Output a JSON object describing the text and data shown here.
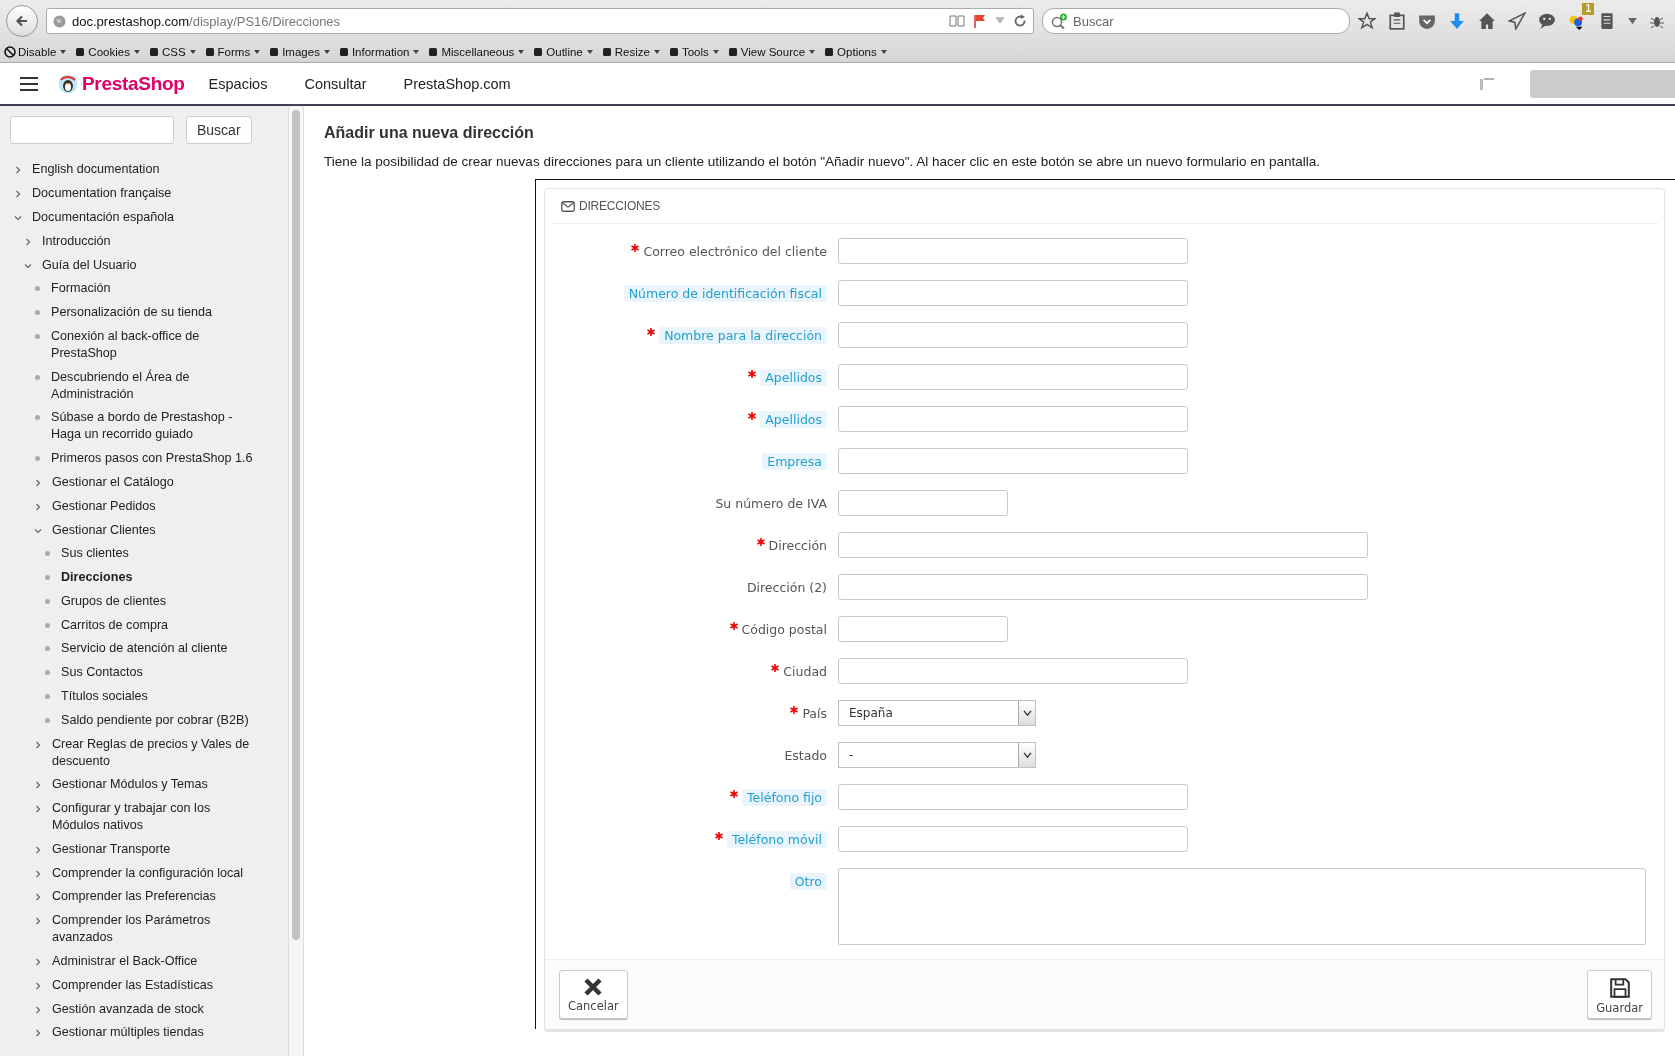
{
  "browser": {
    "url_host": "doc.prestashop.com",
    "url_path": "/display/PS16/Direcciones",
    "search": {
      "placeholder": "Buscar"
    },
    "badge": "1"
  },
  "devtools": [
    "Disable",
    "Cookies",
    "CSS",
    "Forms",
    "Images",
    "Information",
    "Miscellaneous",
    "Outline",
    "Resize",
    "Tools",
    "View Source",
    "Options"
  ],
  "site": {
    "logo": "PrestaShop",
    "nav": [
      "Espacios",
      "Consultar",
      "PrestaShop.com"
    ]
  },
  "sidebar": {
    "search_button": "Buscar",
    "items": [
      {
        "label": "English documentation",
        "kind": "folder",
        "expanded": false,
        "selected": false
      },
      {
        "label": "Documentation française",
        "kind": "folder",
        "expanded": false,
        "selected": false
      },
      {
        "label": "Documentación española",
        "kind": "folder",
        "expanded": true,
        "selected": false,
        "children": [
          {
            "label": "Introducción",
            "kind": "folder",
            "expanded": false,
            "selected": false
          },
          {
            "label": "Guía del Usuario",
            "kind": "folder",
            "expanded": true,
            "selected": false,
            "children": [
              {
                "label": "Formación",
                "kind": "page",
                "selected": false
              },
              {
                "label": "Personalización de su tienda",
                "kind": "page",
                "selected": false
              },
              {
                "label": "Conexión al back-office de PrestaShop",
                "kind": "page",
                "selected": false
              },
              {
                "label": "Descubriendo el Área de Administración",
                "kind": "page",
                "selected": false
              },
              {
                "label": "Súbase a bordo de Prestashop - Haga un recorrido guiado",
                "kind": "page",
                "selected": false
              },
              {
                "label": "Primeros pasos con PrestaShop 1.6",
                "kind": "page",
                "selected": false
              },
              {
                "label": "Gestionar el Catálogo",
                "kind": "folder",
                "expanded": false,
                "selected": false
              },
              {
                "label": "Gestionar Pedidos",
                "kind": "folder",
                "expanded": false,
                "selected": false
              },
              {
                "label": "Gestionar Clientes",
                "kind": "folder",
                "expanded": true,
                "selected": false,
                "children": [
                  {
                    "label": "Sus clientes",
                    "kind": "page",
                    "selected": false
                  },
                  {
                    "label": "Direcciones",
                    "kind": "page",
                    "selected": true
                  },
                  {
                    "label": "Grupos de clientes",
                    "kind": "page",
                    "selected": false
                  },
                  {
                    "label": "Carritos de compra",
                    "kind": "page",
                    "selected": false
                  },
                  {
                    "label": "Servicio de atención al cliente",
                    "kind": "page",
                    "selected": false
                  },
                  {
                    "label": "Sus Contactos",
                    "kind": "page",
                    "selected": false
                  },
                  {
                    "label": "Títulos sociales",
                    "kind": "page",
                    "selected": false
                  },
                  {
                    "label": "Saldo pendiente por cobrar (B2B)",
                    "kind": "page",
                    "selected": false
                  }
                ]
              },
              {
                "label": "Crear Reglas de precios y Vales de descuento",
                "kind": "folder",
                "expanded": false,
                "selected": false
              },
              {
                "label": "Gestionar Módulos y Temas",
                "kind": "folder",
                "expanded": false,
                "selected": false
              },
              {
                "label": "Configurar y trabajar con los Módulos nativos",
                "kind": "folder",
                "expanded": false,
                "selected": false
              },
              {
                "label": "Gestionar Transporte",
                "kind": "folder",
                "expanded": false,
                "selected": false
              },
              {
                "label": "Comprender la configuración local",
                "kind": "folder",
                "expanded": false,
                "selected": false
              },
              {
                "label": "Comprender las Preferencias",
                "kind": "folder",
                "expanded": false,
                "selected": false
              },
              {
                "label": "Comprender los Parámetros avanzados",
                "kind": "folder",
                "expanded": false,
                "selected": false
              },
              {
                "label": "Administrar el Back-Office",
                "kind": "folder",
                "expanded": false,
                "selected": false
              },
              {
                "label": "Comprender las Estadísticas",
                "kind": "folder",
                "expanded": false,
                "selected": false
              },
              {
                "label": "Gestión avanzada de stock",
                "kind": "folder",
                "expanded": false,
                "selected": false
              },
              {
                "label": "Gestionar múltiples tiendas",
                "kind": "folder",
                "expanded": false,
                "selected": false
              }
            ]
          }
        ]
      }
    ]
  },
  "article": {
    "title": "Añadir una nueva dirección",
    "intro": "Tiene la posibilidad de crear nuevas direcciones para un cliente utilizando el botón \"Añadir nuevo\". Al hacer clic en este botón se abre un nuevo formulario en pantalla."
  },
  "form": {
    "heading": "DIRECCIONES",
    "fields": [
      {
        "label": "Correo electrónico del cliente",
        "required": true,
        "help": false,
        "kind": "text"
      },
      {
        "label": "Número de identificación fiscal",
        "required": false,
        "help": true,
        "kind": "text"
      },
      {
        "label": "Nombre para la dirección",
        "required": true,
        "help": true,
        "kind": "text"
      },
      {
        "label": "Apellidos",
        "required": true,
        "help": true,
        "kind": "text"
      },
      {
        "label": "Apellidos",
        "required": true,
        "help": true,
        "kind": "text"
      },
      {
        "label": "Empresa",
        "required": false,
        "help": true,
        "kind": "text"
      },
      {
        "label": "Su número de IVA",
        "required": false,
        "help": false,
        "kind": "short"
      },
      {
        "label": "Dirección",
        "required": true,
        "help": false,
        "kind": "long"
      },
      {
        "label": "Dirección (2)",
        "required": false,
        "help": false,
        "kind": "long"
      },
      {
        "label": "Código postal",
        "required": true,
        "help": false,
        "kind": "short"
      },
      {
        "label": "Ciudad",
        "required": true,
        "help": false,
        "kind": "text"
      },
      {
        "label": "País",
        "required": true,
        "help": false,
        "kind": "select",
        "value": "España"
      },
      {
        "label": "Estado",
        "required": false,
        "help": false,
        "kind": "select",
        "value": "-"
      },
      {
        "label": "Teléfono fijo",
        "required": true,
        "help": true,
        "kind": "text"
      },
      {
        "label": "Teléfono móvil",
        "required": true,
        "help": true,
        "kind": "text"
      },
      {
        "label": "Otro",
        "required": false,
        "help": true,
        "kind": "textarea"
      }
    ],
    "cancel": "Cancelar",
    "save": "Guardar"
  }
}
